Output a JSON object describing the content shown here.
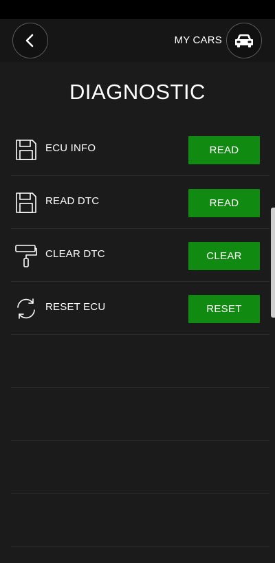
{
  "header": {
    "my_cars_label": "MY CARS",
    "back_icon": "chevron-left-icon",
    "car_icon": "car-icon"
  },
  "page": {
    "title": "DIAGNOSTIC"
  },
  "rows": [
    {
      "label": "ECU INFO",
      "icon": "floppy-disk-icon",
      "button": "READ"
    },
    {
      "label": "READ DTC",
      "icon": "floppy-disk-icon",
      "button": "READ"
    },
    {
      "label": "CLEAR DTC",
      "icon": "paint-roller-icon",
      "button": "CLEAR"
    },
    {
      "label": "RESET ECU",
      "icon": "refresh-icon",
      "button": "RESET"
    }
  ],
  "colors": {
    "background": "#1b1b1b",
    "top_bar": "#161616",
    "accent_green": "#108a10",
    "divider": "#2b2b2b",
    "text": "#ffffff"
  }
}
